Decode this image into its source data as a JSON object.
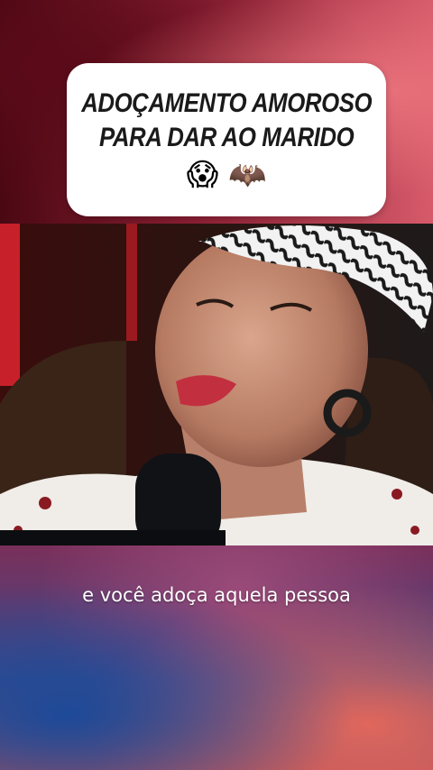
{
  "title_card": {
    "line1": "ADOÇAMENTO AMOROSO",
    "line2": "PARA DAR AO MARIDO",
    "emoji_1": "😱",
    "emoji_2": "🦇"
  },
  "video": {
    "description": "podcast guest speaking into microphone"
  },
  "subtitle": {
    "text": "e você adoça aquela pessoa"
  },
  "colors": {
    "card_bg": "#ffffff",
    "title_text": "#1a1a1a",
    "subtitle_text": "#ffffff"
  }
}
